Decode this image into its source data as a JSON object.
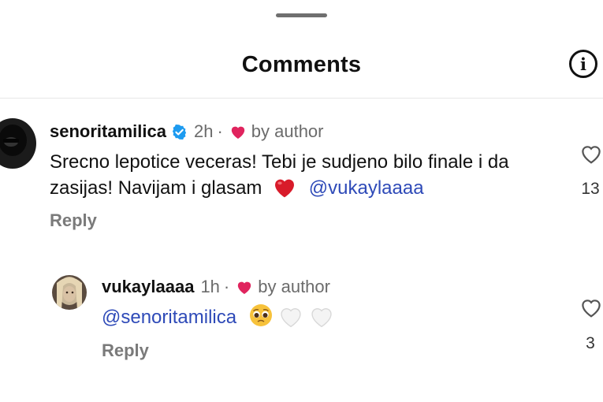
{
  "sheet": {
    "title": "Comments",
    "info_icon": "info-icon"
  },
  "comments": [
    {
      "username": "senoritamilica",
      "verified": true,
      "time": "2h",
      "dot": "·",
      "liked_by": "by author",
      "text": "Srecno lepotice veceras! Tebi je sudjeno bilo finale i da zasijas! Navijam i glasam",
      "text_emoji": "heart-emoji",
      "mention": "@vukaylaaaa",
      "reply_label": "Reply",
      "like_count": "13"
    },
    {
      "username": "vukaylaaaa",
      "verified": false,
      "time": "1h",
      "dot": "·",
      "liked_by": "by author",
      "mention": "@senoritamilica",
      "emojis": [
        "pleading-face-emoji",
        "white-heart-emoji",
        "white-heart-emoji"
      ],
      "reply_label": "Reply",
      "like_count": "3"
    }
  ],
  "colors": {
    "heart": "#e0245e",
    "mention": "#2e4ab8",
    "verified": "#1d9bf0",
    "muted": "#6b6b6b"
  }
}
